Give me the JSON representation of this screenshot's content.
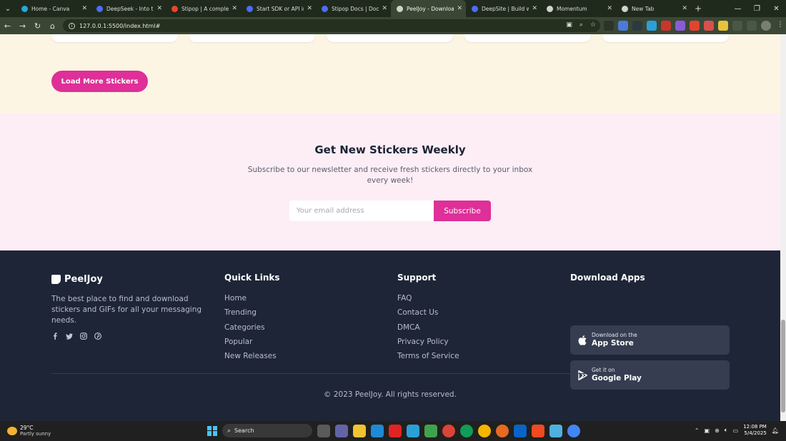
{
  "browser": {
    "tabs": [
      {
        "title": "Home - Canva",
        "color": "#2aa6d8"
      },
      {
        "title": "DeepSeek - Into the Unknown",
        "color": "#4d6bfe"
      },
      {
        "title": "Stipop | A complete sticker",
        "color": "#e8452c"
      },
      {
        "title": "Start SDK or API integration",
        "color": "#4d6bfe"
      },
      {
        "title": "Stipop Docs | Documentation",
        "color": "#4d6bfe"
      },
      {
        "title": "PeelJoy - Download Free",
        "color": "#cfd4ca",
        "active": true
      },
      {
        "title": "DeepSite | Build with AI",
        "color": "#4d6bfe"
      },
      {
        "title": "Momentum",
        "color": "#cfd4ca"
      },
      {
        "title": "New Tab",
        "color": "#cfd4ca"
      }
    ],
    "url": "127.0.0.1:5500/index.html#"
  },
  "sticker_section": {
    "load_more_label": "Load More Stickers"
  },
  "newsletter": {
    "title": "Get New Stickers Weekly",
    "subtitle": "Subscribe to our newsletter and receive fresh stickers directly to your inbox every week!",
    "email_placeholder": "Your email address",
    "subscribe_label": "Subscribe"
  },
  "footer": {
    "brand": "PeelJoy",
    "description": "The best place to find and download stickers and GIFs for all your messaging needs.",
    "socials": [
      "facebook-icon",
      "twitter-icon",
      "instagram-icon",
      "pinterest-icon"
    ],
    "quick_links": {
      "title": "Quick Links",
      "items": [
        "Home",
        "Trending",
        "Categories",
        "Popular",
        "New Releases"
      ]
    },
    "support": {
      "title": "Support",
      "items": [
        "FAQ",
        "Contact Us",
        "DMCA",
        "Privacy Policy",
        "Terms of Service"
      ]
    },
    "download": {
      "title": "Download Apps",
      "app_store": {
        "small": "Download on the",
        "big": "App Store"
      },
      "google_play": {
        "small": "Get it on",
        "big": "Google Play"
      }
    },
    "copyright": "© 2023 PeelJoy. All rights reserved."
  },
  "taskbar": {
    "weather_temp": "29°C",
    "weather_desc": "Partly sunny",
    "search_label": "Search",
    "time": "12:08 PM",
    "date": "5/4/2025"
  },
  "colors": {
    "accent_pink": "#df2f98",
    "footer_bg": "#1e2537",
    "cream_bg": "#fdf5e3",
    "newsletter_bg": "#fdeef6"
  }
}
